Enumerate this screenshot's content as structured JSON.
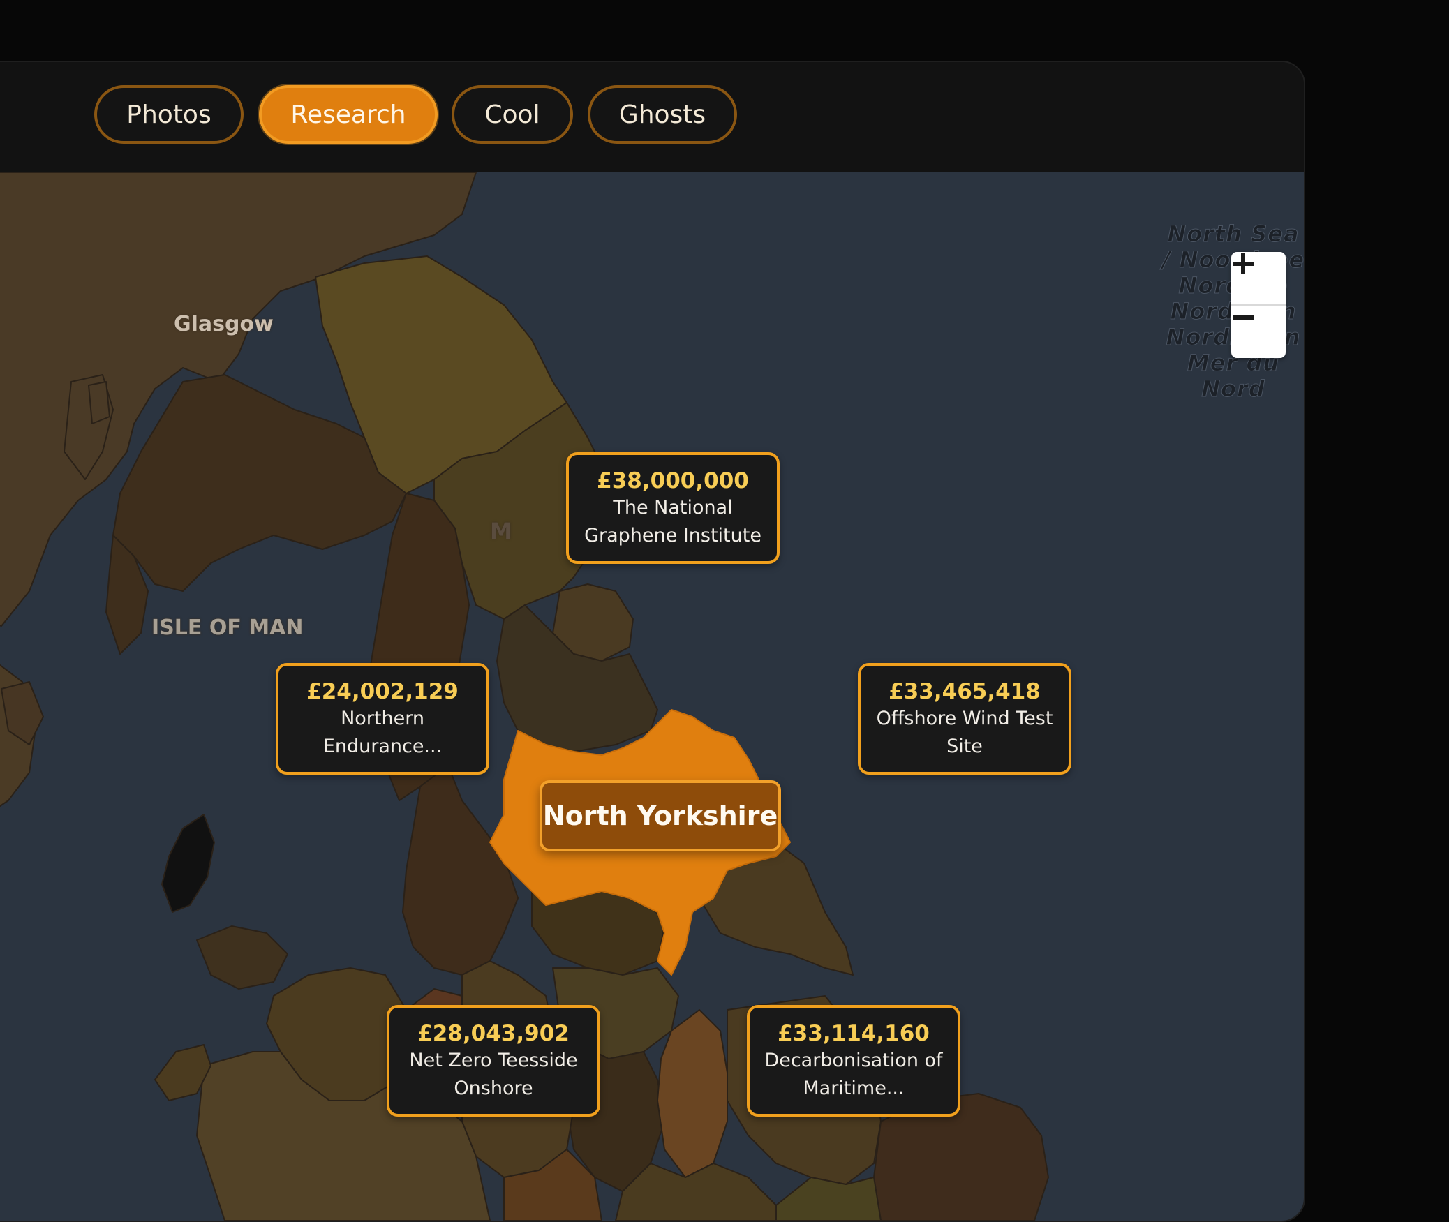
{
  "tabs": [
    {
      "label": "Photos",
      "active": false
    },
    {
      "label": "Research",
      "active": true
    },
    {
      "label": "Cool",
      "active": false
    },
    {
      "label": "Ghosts",
      "active": false
    }
  ],
  "map": {
    "zoom_in_label": "+",
    "zoom_out_label": "−",
    "sea_label_lines": [
      "North Sea",
      "/ Noordzee",
      "Nordsee",
      "Nordsøen",
      "Nordsjøen",
      "Mer du Nord"
    ],
    "places": {
      "glasgow": "Glasgow",
      "isle_of_man": "ISLE OF MAN",
      "partial_label": "M"
    },
    "selected_region": "North Yorkshire",
    "colors": {
      "sea": "#2b3440",
      "highlight": "#e07f0f",
      "card_border": "#f1a01d",
      "amount": "#f8cd55"
    }
  },
  "projects": [
    {
      "amount": "£38,000,000",
      "name_lines": [
        "The National",
        "Graphene Institute"
      ]
    },
    {
      "amount": "£24,002,129",
      "name_lines": [
        "Northern",
        "Endurance..."
      ]
    },
    {
      "amount": "£33,465,418",
      "name_lines": [
        "Offshore Wind Test",
        "Site"
      ]
    },
    {
      "amount": "£28,043,902",
      "name_lines": [
        "Net Zero Teesside",
        "Onshore"
      ]
    },
    {
      "amount": "£33,114,160",
      "name_lines": [
        "Decarbonisation of",
        "Maritime..."
      ]
    }
  ]
}
